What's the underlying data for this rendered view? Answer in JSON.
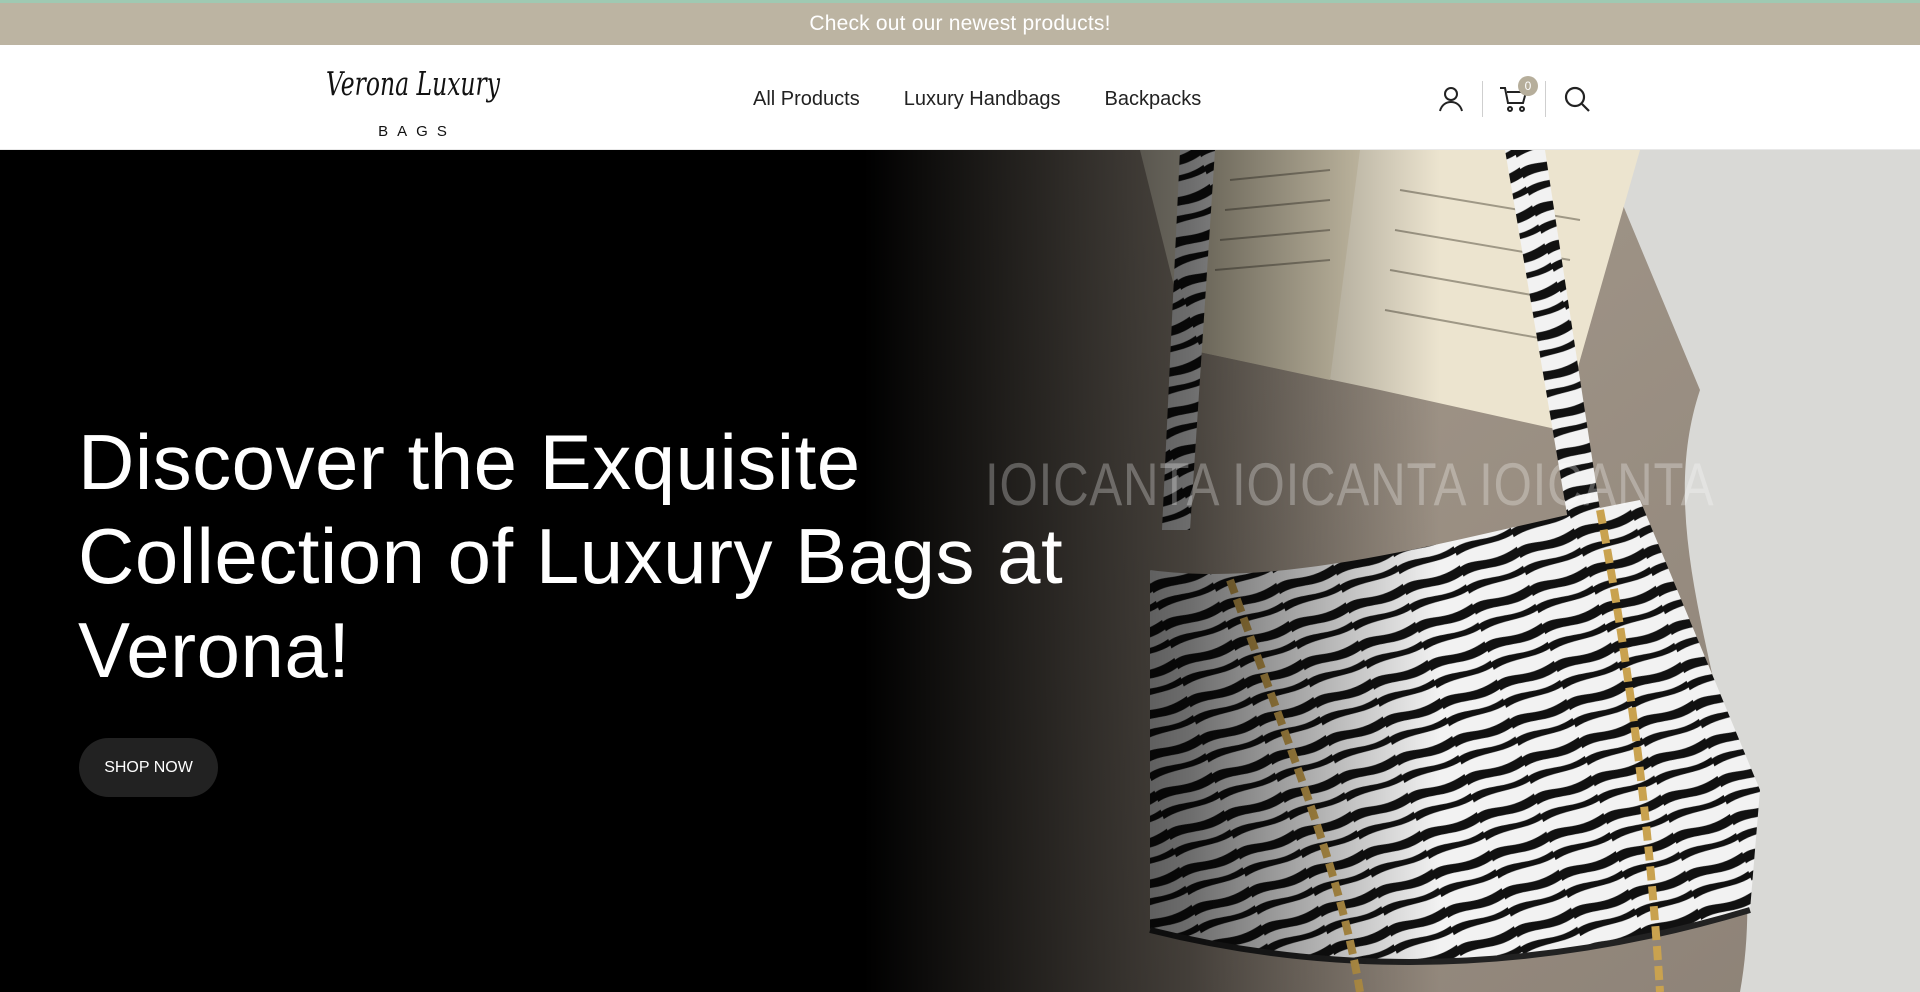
{
  "announcement": {
    "text": "Check out our newest products!",
    "background": "#bcb4a2"
  },
  "brand": {
    "script_name": "Verona Luxury",
    "sub_name": "BAGS"
  },
  "nav": {
    "items": [
      {
        "label": "All Products"
      },
      {
        "label": "Luxury Handbags"
      },
      {
        "label": "Backpacks"
      }
    ]
  },
  "header_icons": {
    "account_icon": "user-icon",
    "cart_icon": "cart-icon",
    "cart_count": "0",
    "search_icon": "search-icon",
    "badge_color": "#b6ae9b"
  },
  "hero": {
    "title": "Discover the Exquisite Collection of Luxury Bags at Verona!",
    "cta_label": "SHOP NOW",
    "image_watermark": "IOICANTA IOICANTA IOICANTA",
    "image_subject": "zebra-print shoulder bag with gold chain on beige coat and open book"
  }
}
